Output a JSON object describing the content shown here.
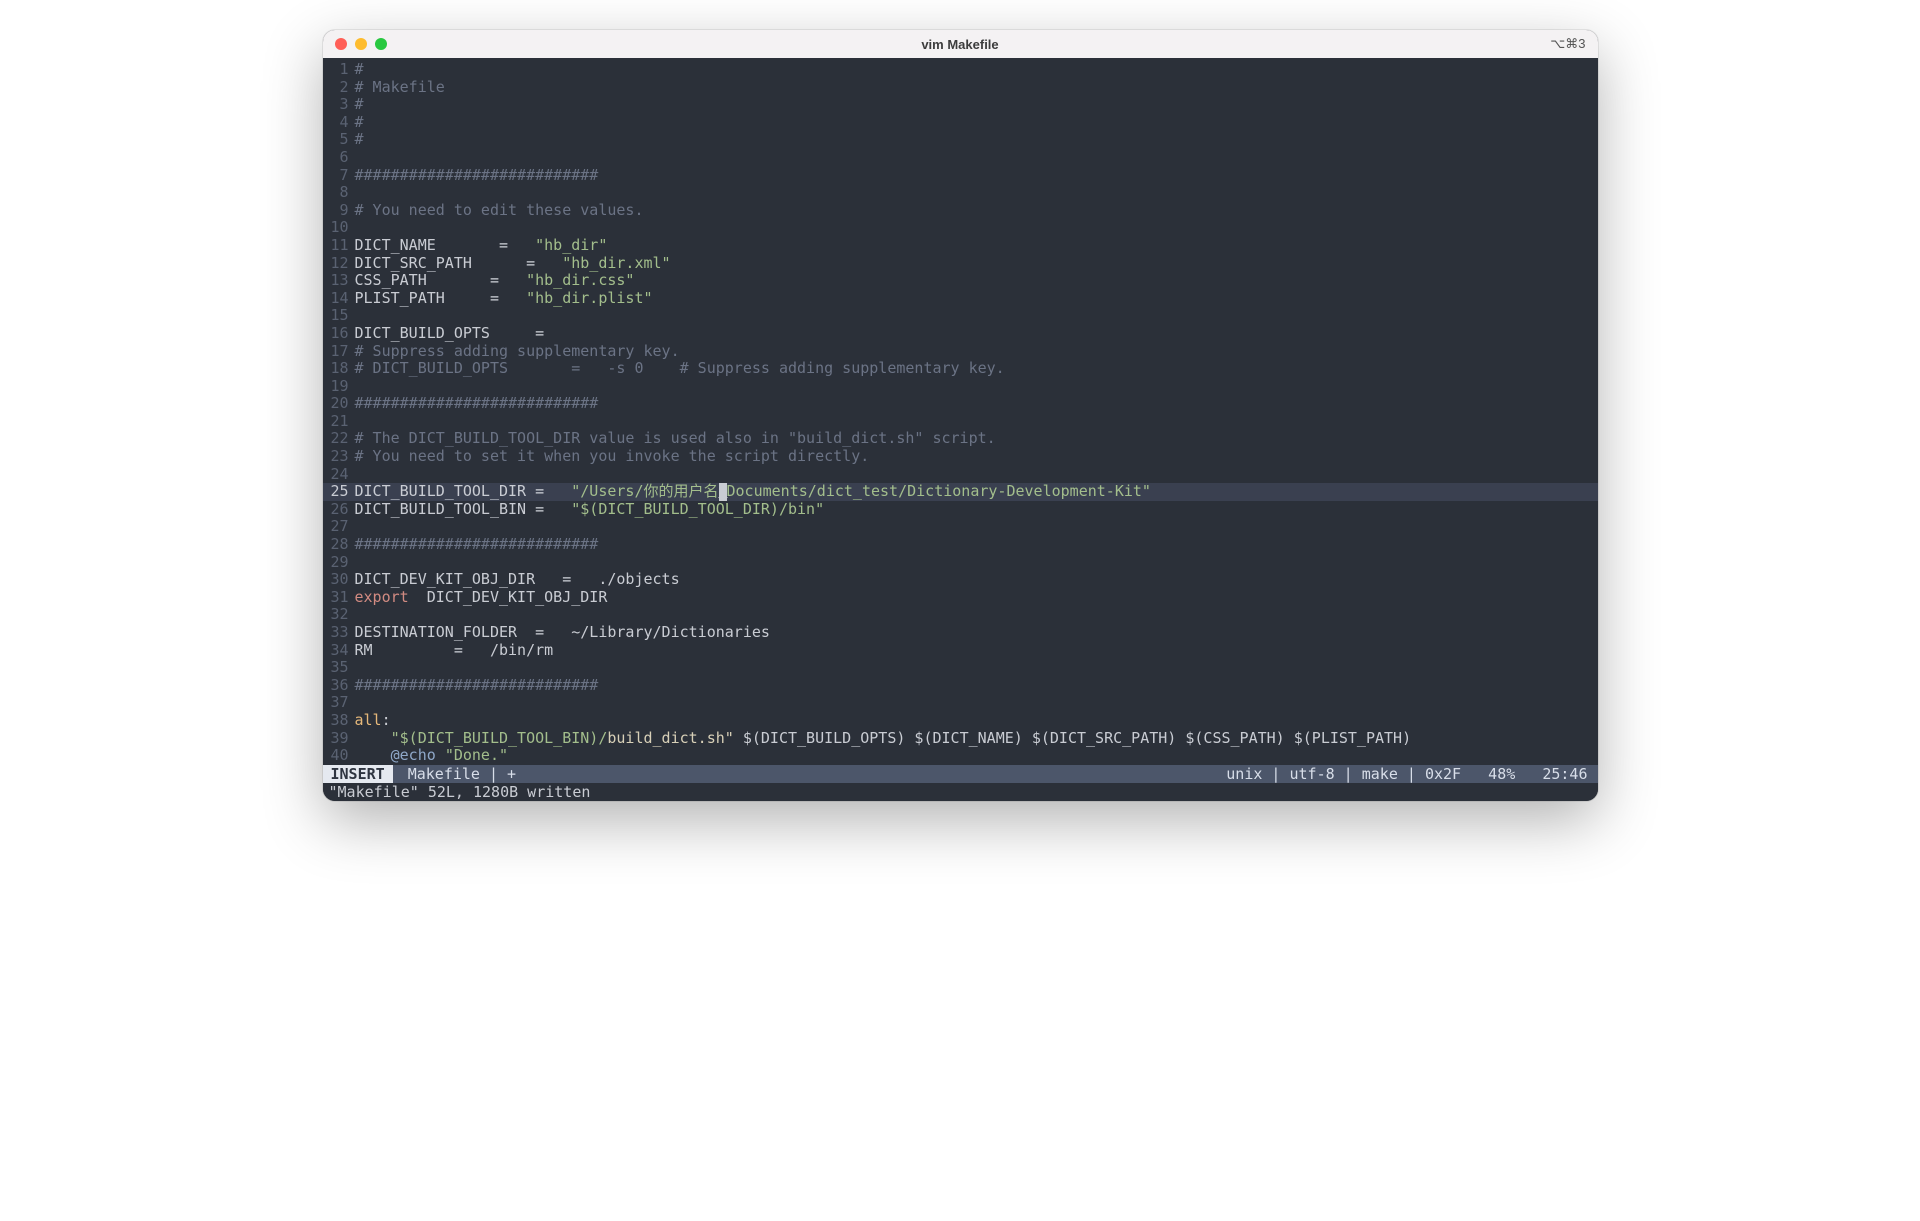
{
  "window": {
    "title": "vim Makefile",
    "shortcut": "⌥⌘3"
  },
  "lines": [
    {
      "n": 1,
      "segs": [
        [
          "comment",
          "#"
        ]
      ]
    },
    {
      "n": 2,
      "segs": [
        [
          "comment",
          "# Makefile"
        ]
      ]
    },
    {
      "n": 3,
      "segs": [
        [
          "comment",
          "#"
        ]
      ]
    },
    {
      "n": 4,
      "segs": [
        [
          "comment",
          "#"
        ]
      ]
    },
    {
      "n": 5,
      "segs": [
        [
          "comment",
          "#"
        ]
      ]
    },
    {
      "n": 6,
      "segs": []
    },
    {
      "n": 7,
      "segs": [
        [
          "comment",
          "###########################"
        ]
      ]
    },
    {
      "n": 8,
      "segs": []
    },
    {
      "n": 9,
      "segs": [
        [
          "comment",
          "# You need to edit these values."
        ]
      ]
    },
    {
      "n": 10,
      "segs": []
    },
    {
      "n": 11,
      "segs": [
        [
          "ident",
          "DICT_NAME"
        ],
        [
          "plain",
          "       "
        ],
        [
          "eq",
          "="
        ],
        [
          "plain",
          "   "
        ],
        [
          "string",
          "\"hb_dir\""
        ]
      ]
    },
    {
      "n": 12,
      "segs": [
        [
          "ident",
          "DICT_SRC_PATH"
        ],
        [
          "plain",
          "      "
        ],
        [
          "eq",
          "="
        ],
        [
          "plain",
          "   "
        ],
        [
          "string",
          "\"hb_dir.xml\""
        ]
      ]
    },
    {
      "n": 13,
      "segs": [
        [
          "ident",
          "CSS_PATH"
        ],
        [
          "plain",
          "       "
        ],
        [
          "eq",
          "="
        ],
        [
          "plain",
          "   "
        ],
        [
          "string",
          "\"hb_dir.css\""
        ]
      ]
    },
    {
      "n": 14,
      "segs": [
        [
          "ident",
          "PLIST_PATH"
        ],
        [
          "plain",
          "     "
        ],
        [
          "eq",
          "="
        ],
        [
          "plain",
          "   "
        ],
        [
          "string",
          "\"hb_dir.plist\""
        ]
      ]
    },
    {
      "n": 15,
      "segs": []
    },
    {
      "n": 16,
      "segs": [
        [
          "ident",
          "DICT_BUILD_OPTS"
        ],
        [
          "plain",
          "     "
        ],
        [
          "eq",
          "="
        ]
      ]
    },
    {
      "n": 17,
      "segs": [
        [
          "comment",
          "# Suppress adding supplementary key."
        ]
      ]
    },
    {
      "n": 18,
      "segs": [
        [
          "comment",
          "# DICT_BUILD_OPTS       =   -s 0    # Suppress adding supplementary key."
        ]
      ]
    },
    {
      "n": 19,
      "segs": []
    },
    {
      "n": 20,
      "segs": [
        [
          "comment",
          "###########################"
        ]
      ]
    },
    {
      "n": 21,
      "segs": []
    },
    {
      "n": 22,
      "segs": [
        [
          "comment",
          "# The DICT_BUILD_TOOL_DIR value is used also in \"build_dict.sh\" script."
        ]
      ]
    },
    {
      "n": 23,
      "segs": [
        [
          "comment",
          "# You need to set it when you invoke the script directly."
        ]
      ]
    },
    {
      "n": 24,
      "segs": []
    },
    {
      "n": 25,
      "hl": true,
      "segs": [
        [
          "ident",
          "DICT_BUILD_TOOL_DIR"
        ],
        [
          "plain",
          " "
        ],
        [
          "eq",
          "="
        ],
        [
          "plain",
          "   "
        ],
        [
          "string",
          "\"/Users/你的用户名"
        ],
        [
          "cursor",
          "/"
        ],
        [
          "string",
          "Documents/dict_test/Dictionary-Development-Kit\""
        ]
      ]
    },
    {
      "n": 26,
      "segs": [
        [
          "ident",
          "DICT_BUILD_TOOL_BIN"
        ],
        [
          "plain",
          " "
        ],
        [
          "eq",
          "="
        ],
        [
          "plain",
          "   "
        ],
        [
          "string",
          "\"$(DICT_BUILD_TOOL_DIR)/bin\""
        ]
      ]
    },
    {
      "n": 27,
      "segs": []
    },
    {
      "n": 28,
      "segs": [
        [
          "comment",
          "###########################"
        ]
      ]
    },
    {
      "n": 29,
      "segs": []
    },
    {
      "n": 30,
      "segs": [
        [
          "ident",
          "DICT_DEV_KIT_OBJ_DIR"
        ],
        [
          "plain",
          "   "
        ],
        [
          "eq",
          "="
        ],
        [
          "plain",
          "   "
        ],
        [
          "ident",
          "./objects"
        ]
      ]
    },
    {
      "n": 31,
      "segs": [
        [
          "keyword",
          "export"
        ],
        [
          "plain",
          "  "
        ],
        [
          "ident",
          "DICT_DEV_KIT_OBJ_DIR"
        ]
      ]
    },
    {
      "n": 32,
      "segs": []
    },
    {
      "n": 33,
      "segs": [
        [
          "ident",
          "DESTINATION_FOLDER"
        ],
        [
          "plain",
          "  "
        ],
        [
          "eq",
          "="
        ],
        [
          "plain",
          "   "
        ],
        [
          "ident",
          "~/Library/Dictionaries"
        ]
      ]
    },
    {
      "n": 34,
      "segs": [
        [
          "ident",
          "RM"
        ],
        [
          "plain",
          "         "
        ],
        [
          "eq",
          "="
        ],
        [
          "plain",
          "   "
        ],
        [
          "ident",
          "/bin/rm"
        ]
      ]
    },
    {
      "n": 35,
      "segs": []
    },
    {
      "n": 36,
      "segs": [
        [
          "comment",
          "###########################"
        ]
      ]
    },
    {
      "n": 37,
      "segs": []
    },
    {
      "n": 38,
      "segs": [
        [
          "target",
          "all"
        ],
        [
          "punct",
          ":"
        ]
      ]
    },
    {
      "n": 39,
      "segs": [
        [
          "plain",
          "    "
        ],
        [
          "string",
          "\"$(DICT_BUILD_TOOL_BIN)/"
        ],
        [
          "stringdim",
          "build_dict.sh\""
        ],
        [
          "plain",
          " "
        ],
        [
          "ident",
          "$(DICT_BUILD_OPTS) $(DICT_NAME) $(DICT_SRC_PATH) $(CSS_PATH) $(PLIST_PATH)"
        ]
      ]
    },
    {
      "n": 40,
      "segs": [
        [
          "plain",
          "    "
        ],
        [
          "echo",
          "@echo"
        ],
        [
          "plain",
          " "
        ],
        [
          "string",
          "\"Done.\""
        ]
      ]
    }
  ],
  "status": {
    "mode": "INSERT",
    "left": " Makefile | +",
    "right": "unix | utf-8 | make | 0x2F   48%   25:46"
  },
  "cmdline": "\"Makefile\" 52L, 1280B written"
}
